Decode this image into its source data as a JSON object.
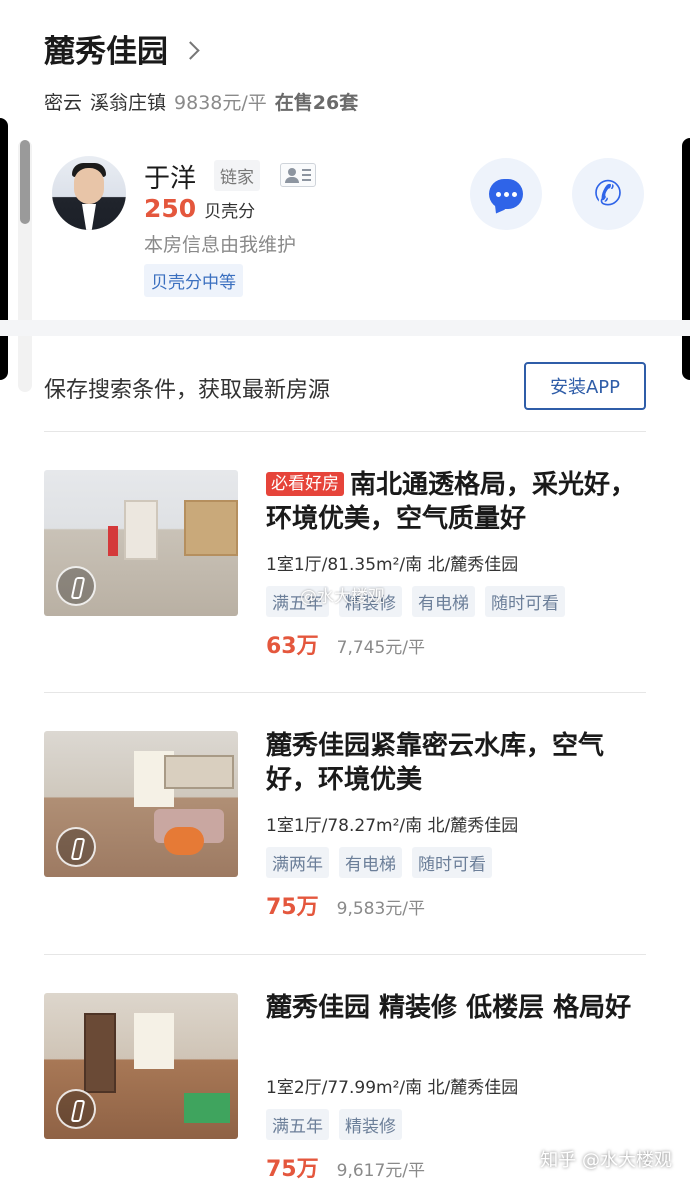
{
  "community": {
    "name": "麓秀佳园",
    "district": "密云",
    "town": "溪翁庄镇",
    "avg_price": "9838元/平",
    "on_sale": "在售26套"
  },
  "agent": {
    "name": "于洋",
    "brand": "链家",
    "score": "250",
    "score_label": "贝壳分",
    "note": "本房信息由我维护",
    "level": "贝壳分中等",
    "icons": {
      "chat": "chat-bubble-icon",
      "call": "phone-icon",
      "card": "business-card-icon"
    },
    "accent": "#2f64e8"
  },
  "save_search": {
    "text": "保存搜索条件，获取最新房源",
    "install_button": "安装APP"
  },
  "listings": [
    {
      "badge": "必看好房",
      "title": "南北通透格局，采光好，环境优美，空气质量好",
      "info": "1室1厅/81.35m²/南 北/麓秀佳园",
      "tags": [
        "满五年",
        "精装修",
        "有电梯",
        "随时可看"
      ],
      "total": "63万",
      "unit_price": "7,745元/平"
    },
    {
      "title": "麓秀佳园紧靠密云水库，空气好，环境优美",
      "info": "1室1厅/78.27m²/南 北/麓秀佳园",
      "tags": [
        "满两年",
        "有电梯",
        "随时可看"
      ],
      "total": "75万",
      "unit_price": "9,583元/平"
    },
    {
      "title": "麓秀佳园 精装修 低楼层 格局好",
      "info": "1室2厅/77.99m²/南 北/麓秀佳园",
      "tags": [
        "满五年",
        "精装修"
      ],
      "total": "75万",
      "unit_price": "9,617元/平"
    }
  ],
  "watermark": {
    "overlay": "@水大楼观",
    "corner": "知乎 @水大楼观"
  },
  "colors": {
    "price_red": "#e4573d",
    "badge_red": "#e6443a",
    "tag_text": "#6c7f99",
    "install_blue": "#2f5da8"
  }
}
